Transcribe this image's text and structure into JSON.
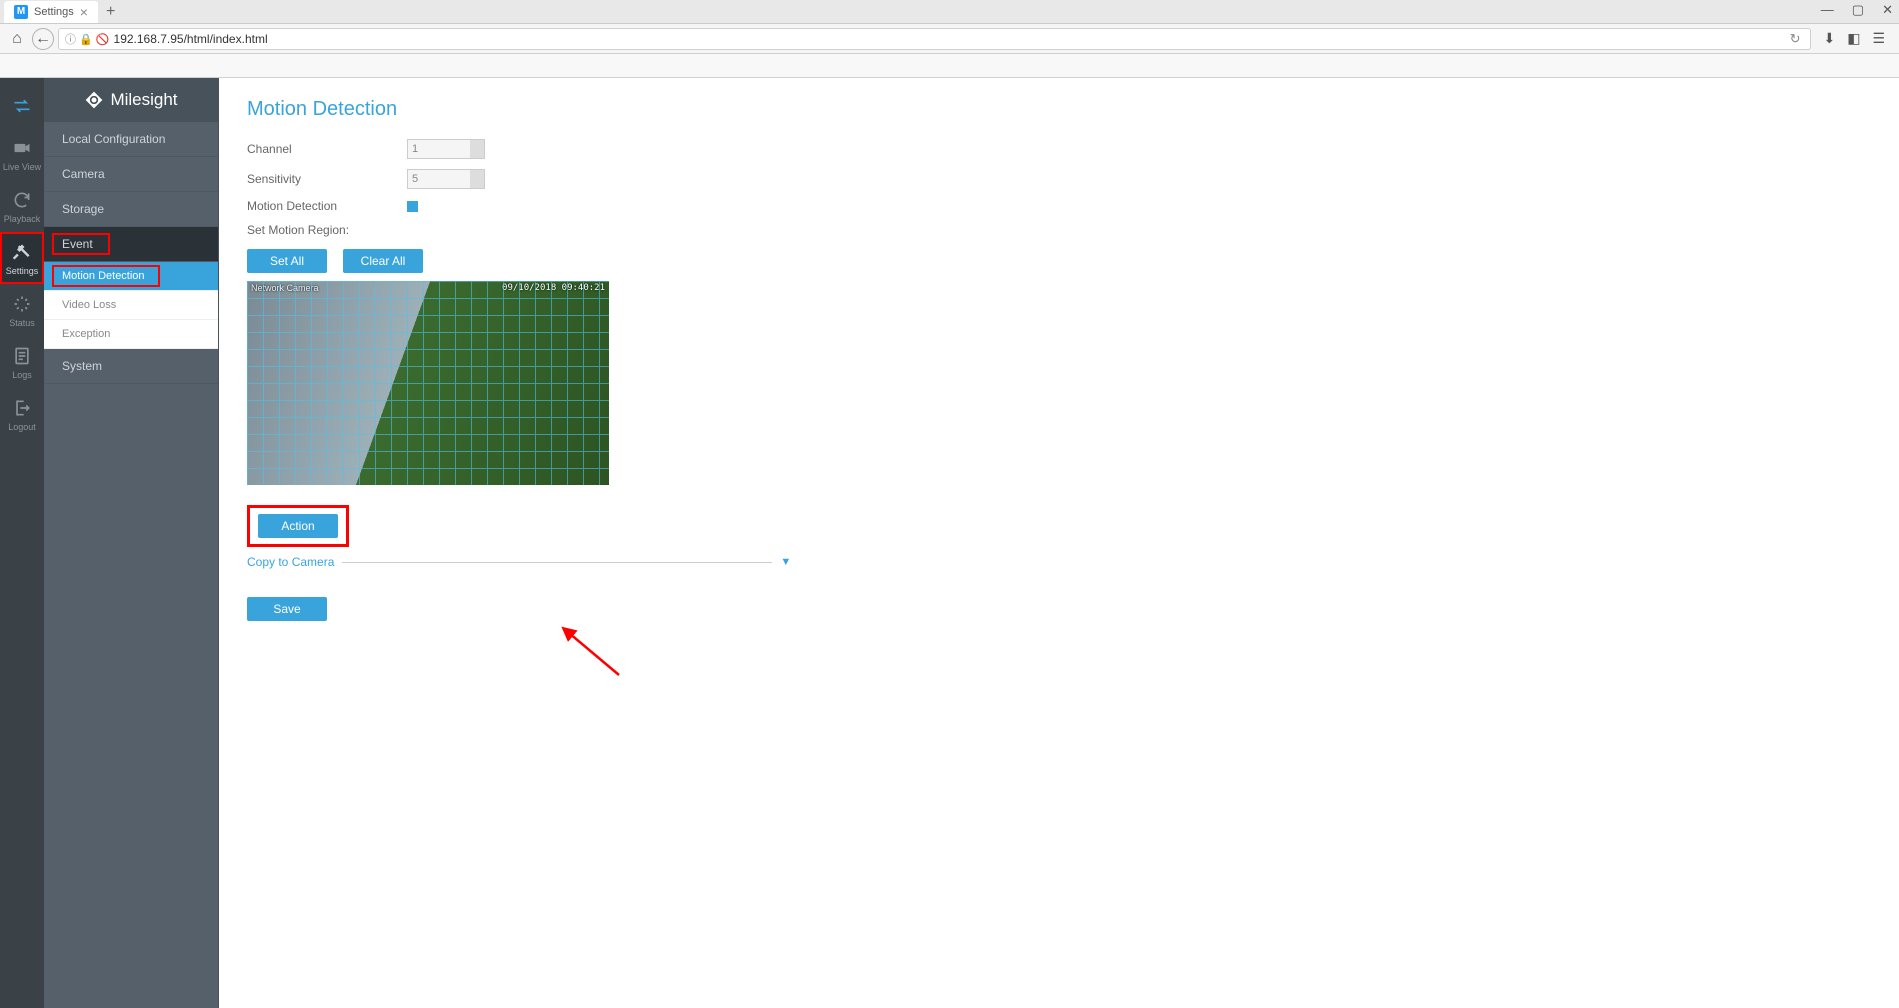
{
  "browser": {
    "tab_title": "Settings",
    "url": "192.168.7.95/html/index.html"
  },
  "rail": [
    {
      "label": "",
      "icon": "swap"
    },
    {
      "label": "Live View",
      "icon": "camera"
    },
    {
      "label": "Playback",
      "icon": "refresh"
    },
    {
      "label": "Settings",
      "icon": "tools",
      "active": true,
      "highlighted": true
    },
    {
      "label": "Status",
      "icon": "sparkle"
    },
    {
      "label": "Logs",
      "icon": "doc"
    },
    {
      "label": "Logout",
      "icon": "logout"
    }
  ],
  "brand": "Milesight",
  "nav": {
    "items": [
      "Local Configuration",
      "Camera",
      "Storage",
      "Event",
      "System"
    ],
    "active": "Event",
    "sub": [
      "Motion Detection",
      "Video Loss",
      "Exception"
    ],
    "sub_active": "Motion Detection"
  },
  "page": {
    "title": "Motion Detection",
    "channel_label": "Channel",
    "channel_value": "1",
    "sensitivity_label": "Sensitivity",
    "sensitivity_value": "5",
    "motion_label": "Motion Detection",
    "region_label": "Set Motion Region:",
    "set_all": "Set All",
    "clear_all": "Clear All",
    "video_timestamp": "09/10/2018 09:40:21",
    "video_text": "Network Camera",
    "action": "Action",
    "copy_to_camera": "Copy to Camera",
    "save": "Save"
  }
}
